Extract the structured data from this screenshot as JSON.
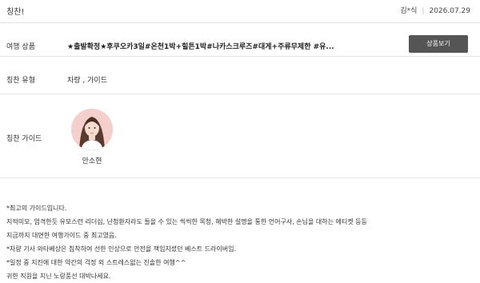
{
  "header": {
    "title": "칭찬!",
    "author": "김*식",
    "date": "2026.07.29"
  },
  "product": {
    "label": "여행 상품",
    "value": "★출발확정★후쿠오카3일#온천1박+힐튼1박#나카스크루즈#대게+주류무제한 #유...",
    "button": "상품보기"
  },
  "praise_type": {
    "label": "칭찬 유형",
    "value": "차량 , 가이드"
  },
  "praise_guide": {
    "label": "칭찬 가이드",
    "name": "안소현"
  },
  "review": {
    "lines": [
      "*최고의 가이드입니다.",
      "지적미모, 엄격한듯 유모스런 리더십, 난청환자라도 들을 수 있는 씩씩한 목청, 해박한 설명을 통한 언어구사, 손님을 대하는 에티켓 등등",
      "지금까지 대면한 여행가이드 중 최고였음.",
      "*차량 기사 와타베상은 침착하여 선한 인상으로 안전을 책임지셨던 베스트 드라이버임.",
      "*일정 중 지진에 대한 약간의 걱정 외 스트레스없는 진솔한 여행^^",
      "귀한 직원을 지닌 노랑풍선 대박나세요."
    ]
  }
}
